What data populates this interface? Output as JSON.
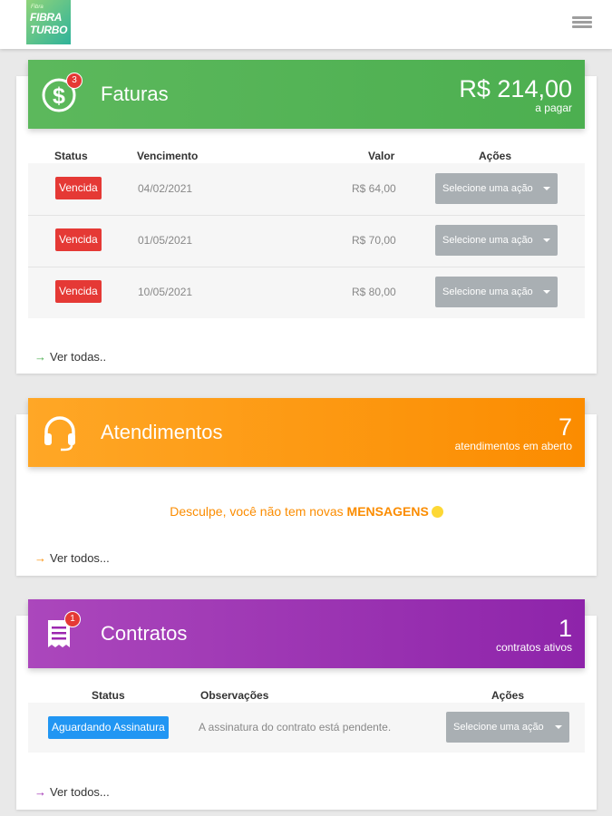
{
  "brand": {
    "line1": "Fibra",
    "line2": "FIBRA",
    "line3": "TURBO"
  },
  "faturas": {
    "title": "Faturas",
    "badge": "3",
    "amount": "R$ 214,00",
    "amount_caption": "a pagar",
    "columns": [
      "Status",
      "Vencimento",
      "Valor",
      "Ações"
    ],
    "rows": [
      {
        "status": "Vencida",
        "vencimento": "04/02/2021",
        "valor": "R$ 64,00",
        "acao": "Selecione uma ação"
      },
      {
        "status": "Vencida",
        "vencimento": "01/05/2021",
        "valor": "R$ 70,00",
        "acao": "Selecione uma ação"
      },
      {
        "status": "Vencida",
        "vencimento": "10/05/2021",
        "valor": "R$ 80,00",
        "acao": "Selecione uma ação"
      }
    ],
    "see_all": "Ver todas.."
  },
  "atendimentos": {
    "title": "Atendimentos",
    "count": "7",
    "count_caption": "atendimentos em aberto",
    "message_prefix": "Desculpe, você não tem novas",
    "message_highlight": "MENSAGENS",
    "see_all": "Ver todos..."
  },
  "contratos": {
    "title": "Contratos",
    "badge": "1",
    "count": "1",
    "count_caption": "contratos ativos",
    "columns": [
      "Status",
      "Observações",
      "Ações"
    ],
    "rows": [
      {
        "status": "Aguardando Assinatura",
        "observacao": "A assinatura do contrato está pendente.",
        "acao": "Selecione uma ação"
      }
    ],
    "see_all": "Ver todos..."
  },
  "colors": {
    "green": "#4caf50",
    "orange": "#fb8c00",
    "purple": "#8e24aa",
    "overdue": "#e53935",
    "pending": "#2196f3"
  },
  "icons": {
    "faturas": "dollar-circle-icon",
    "atendimentos": "headset-icon",
    "contratos": "receipt-icon",
    "menu": "hamburger-menu-icon"
  }
}
